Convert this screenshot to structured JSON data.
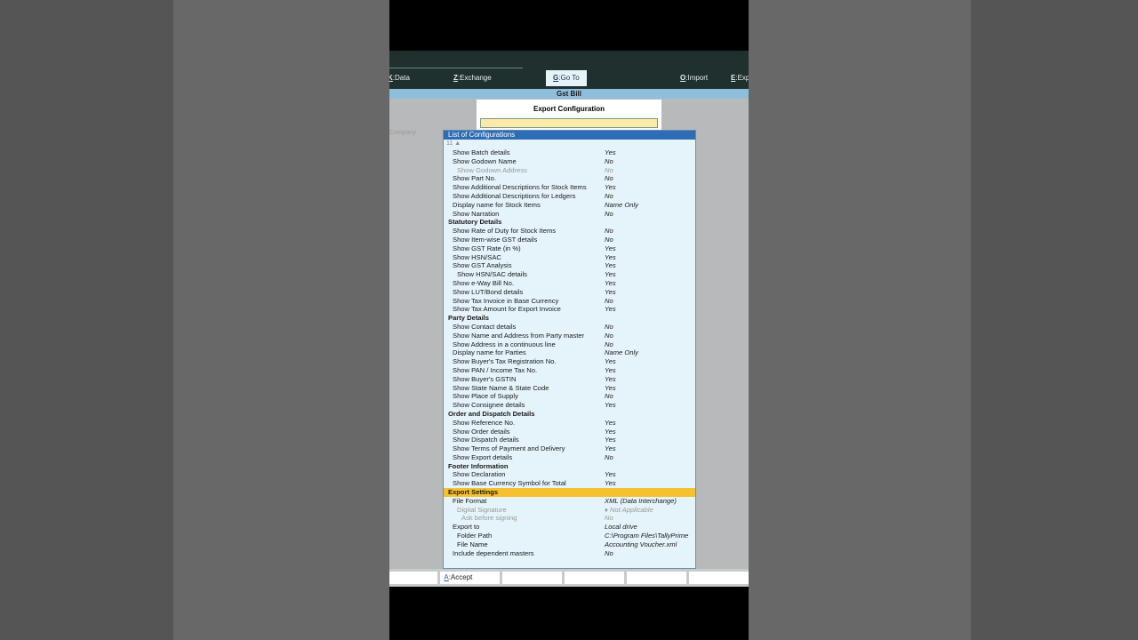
{
  "menu": {
    "data": "Data",
    "data_key": "K",
    "exchange": "Exchange",
    "exchange_key": "Z",
    "goto": "Go To",
    "goto_key": "G",
    "import": "Import",
    "import_key": "O",
    "export": "Exp",
    "export_key": "E"
  },
  "title": "Gst Bill",
  "dialog_title": "Export Configuration",
  "background_label": "Company",
  "list": {
    "title": "List of Configurations",
    "count": "11 ▲",
    "rows": [
      {
        "label": "Show Batch details",
        "value": "Yes",
        "t": ""
      },
      {
        "label": "Show Godown Name",
        "value": "No",
        "t": ""
      },
      {
        "label": "Show Godown Address",
        "value": "No",
        "t": "d",
        "i": 1
      },
      {
        "label": "Show Part No.",
        "value": "No",
        "t": ""
      },
      {
        "label": "Show Additional Descriptions for Stock Items",
        "value": "Yes",
        "t": ""
      },
      {
        "label": "Show Additional Descriptions for Ledgers",
        "value": "No",
        "t": ""
      },
      {
        "label": "Display name for Stock Items",
        "value": "Name Only",
        "t": ""
      },
      {
        "label": "Show Narration",
        "value": "No",
        "t": ""
      },
      {
        "label": "Statutory Details",
        "value": "",
        "t": "h"
      },
      {
        "label": "Show Rate of Duty for Stock Items",
        "value": "No",
        "t": ""
      },
      {
        "label": "Show Item-wise GST details",
        "value": "No",
        "t": ""
      },
      {
        "label": "Show GST Rate (in %)",
        "value": "Yes",
        "t": ""
      },
      {
        "label": "Show HSN/SAC",
        "value": "Yes",
        "t": ""
      },
      {
        "label": "Show GST Analysis",
        "value": "Yes",
        "t": ""
      },
      {
        "label": "Show HSN/SAC details",
        "value": "Yes",
        "t": "",
        "i": 1
      },
      {
        "label": "Show e-Way Bill No.",
        "value": "Yes",
        "t": ""
      },
      {
        "label": "Show LUT/Bond details",
        "value": "Yes",
        "t": ""
      },
      {
        "label": "Show Tax Invoice in Base Currency",
        "value": "No",
        "t": ""
      },
      {
        "label": "Show Tax Amount for Export Invoice",
        "value": "Yes",
        "t": ""
      },
      {
        "label": "Party Details",
        "value": "",
        "t": "h"
      },
      {
        "label": "Show Contact details",
        "value": "No",
        "t": ""
      },
      {
        "label": "Show Name and Address from Party master",
        "value": "No",
        "t": ""
      },
      {
        "label": "Show Address in a continuous line",
        "value": "No",
        "t": ""
      },
      {
        "label": "Display name for Parties",
        "value": "Name Only",
        "t": ""
      },
      {
        "label": "Show Buyer's Tax Registration No.",
        "value": "Yes",
        "t": ""
      },
      {
        "label": "Show PAN / Income Tax No.",
        "value": "Yes",
        "t": ""
      },
      {
        "label": "Show Buyer's GSTIN",
        "value": "Yes",
        "t": ""
      },
      {
        "label": "Show State Name & State Code",
        "value": "Yes",
        "t": ""
      },
      {
        "label": "Show Place of Supply",
        "value": "No",
        "t": ""
      },
      {
        "label": "Show Consignee details",
        "value": "Yes",
        "t": ""
      },
      {
        "label": "Order and Dispatch Details",
        "value": "",
        "t": "h"
      },
      {
        "label": "Show Reference No.",
        "value": "Yes",
        "t": ""
      },
      {
        "label": "Show Order details",
        "value": "Yes",
        "t": ""
      },
      {
        "label": "Show Dispatch details",
        "value": "Yes",
        "t": ""
      },
      {
        "label": "Show Terms of Payment and Delivery",
        "value": "Yes",
        "t": ""
      },
      {
        "label": "Show Export details",
        "value": "No",
        "t": ""
      },
      {
        "label": "Footer Information",
        "value": "",
        "t": "h"
      },
      {
        "label": "Show Declaration",
        "value": "Yes",
        "t": ""
      },
      {
        "label": "Show Base Currency Symbol for Total",
        "value": "Yes",
        "t": ""
      },
      {
        "label": "Export Settings",
        "value": "",
        "t": "h hl"
      },
      {
        "label": "File Format",
        "value": "XML (Data Interchange)",
        "t": ""
      },
      {
        "label": "Digital Signature",
        "value": "♦ Not Applicable",
        "t": "d",
        "i": 1
      },
      {
        "label": "Ask before signing",
        "value": "No",
        "t": "d",
        "i": 2
      },
      {
        "label": "Export to",
        "value": "Local drive",
        "t": ""
      },
      {
        "label": "Folder Path",
        "value": "C:\\Program Files\\TallyPrime",
        "t": "",
        "i": 1
      },
      {
        "label": "File Name",
        "value": "Accounting Voucher.xml",
        "t": "",
        "i": 1
      },
      {
        "label": "Include dependent masters",
        "value": "No",
        "t": ""
      }
    ]
  },
  "bottom": {
    "accept_key": "A",
    "accept": "Accept"
  }
}
